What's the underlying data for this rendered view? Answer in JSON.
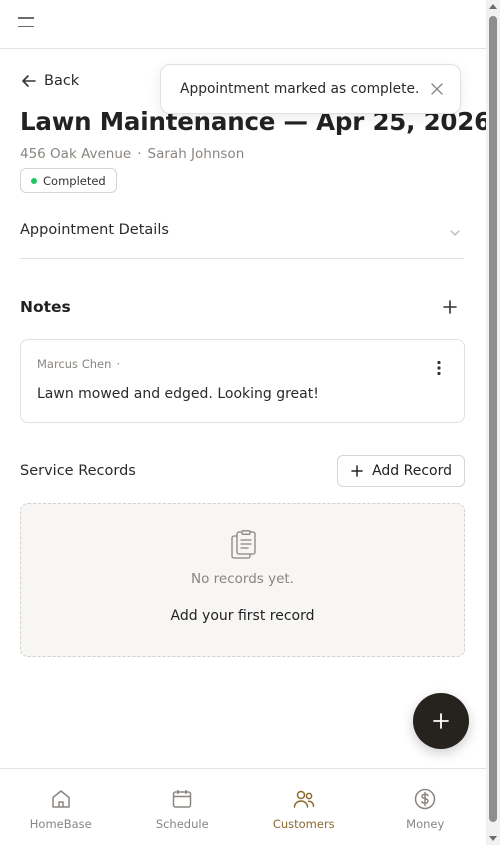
{
  "header": {
    "menu_icon": "hamburger-menu-icon"
  },
  "back": {
    "label": "Back"
  },
  "toast": {
    "message": "Appointment marked as complete."
  },
  "appointment": {
    "title": "Lawn Maintenance — Apr 25, 2026",
    "address": "456 Oak Avenue",
    "separator": "·",
    "customer": "Sarah Johnson",
    "status": "Completed",
    "status_color": "#22c55e"
  },
  "details": {
    "label": "Appointment Details"
  },
  "notes": {
    "label": "Notes",
    "items": [
      {
        "author": "Marcus Chen",
        "separator": "·",
        "text": "Lawn mowed and edged. Looking great!"
      }
    ]
  },
  "records": {
    "label": "Service Records",
    "add_label": "Add Record",
    "empty_text": "No records yet.",
    "empty_action": "Add your first record"
  },
  "nav": {
    "items": [
      {
        "label": "HomeBase",
        "icon": "home-icon"
      },
      {
        "label": "Schedule",
        "icon": "calendar-icon"
      },
      {
        "label": "Customers",
        "icon": "users-icon",
        "active": true
      },
      {
        "label": "Money",
        "icon": "dollar-icon"
      }
    ],
    "active_color": "#8a6a2f"
  }
}
